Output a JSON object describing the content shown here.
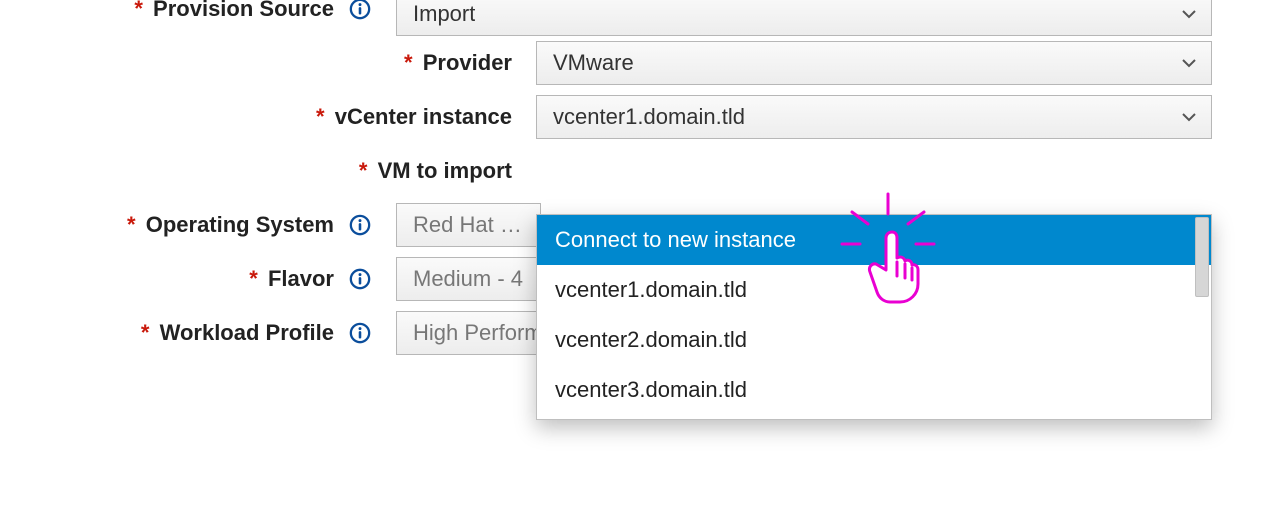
{
  "provisionSource": {
    "label": "Provision Source",
    "value": "Import"
  },
  "provider": {
    "label": "Provider",
    "value": "VMware"
  },
  "vcenterInstance": {
    "label": "vCenter instance",
    "value": "vcenter1.domain.tld",
    "options": {
      "connectNew": "Connect to new instance",
      "o1": "vcenter1.domain.tld",
      "o2": "vcenter2.domain.tld",
      "o3": "vcenter3.domain.tld"
    }
  },
  "vmToImport": {
    "label": "VM to import"
  },
  "operatingSystem": {
    "label": "Operating System",
    "placeholder": "Red Hat En"
  },
  "flavor": {
    "label": "Flavor",
    "placeholder": "Medium - 4"
  },
  "workloadProfile": {
    "label": "Workload Profile",
    "placeholder": "High Performance"
  },
  "colors": {
    "accent": "#0088ce",
    "infoIcon": "#0b4e9c",
    "required": "#c9190b",
    "highlightCursor": "#e900d2"
  }
}
